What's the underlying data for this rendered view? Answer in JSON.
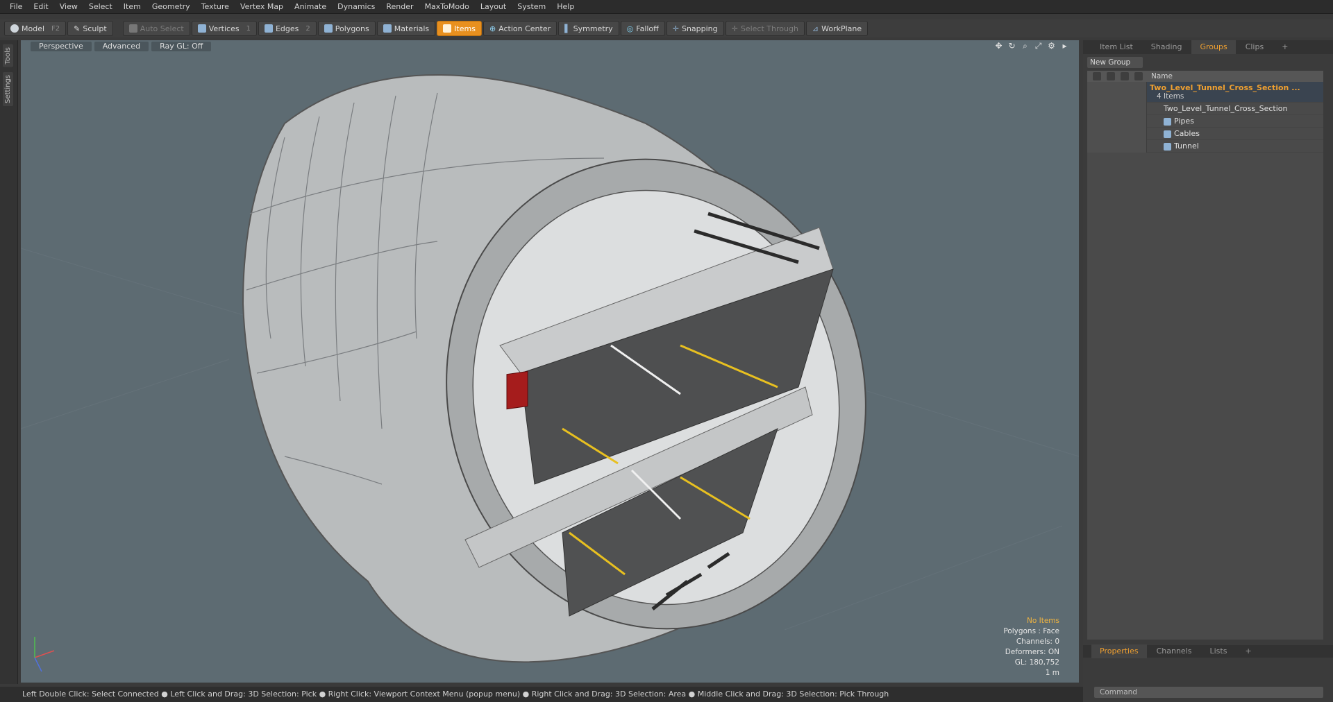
{
  "menu": [
    "File",
    "Edit",
    "View",
    "Select",
    "Item",
    "Geometry",
    "Texture",
    "Vertex Map",
    "Animate",
    "Dynamics",
    "Render",
    "MaxToModo",
    "Layout",
    "System",
    "Help"
  ],
  "toolbar": {
    "model": "Model",
    "model_key": "F2",
    "sculpt": "Sculpt",
    "auto_select": "Auto Select",
    "vertices": "Vertices",
    "vertices_key": "1",
    "edges": "Edges",
    "edges_key": "2",
    "polygons": "Polygons",
    "materials": "Materials",
    "items": "Items",
    "action_center": "Action Center",
    "symmetry": "Symmetry",
    "falloff": "Falloff",
    "snapping": "Snapping",
    "select_through": "Select Through",
    "workplane": "WorkPlane"
  },
  "left_tabs": [
    "Tools",
    "Settings"
  ],
  "viewport": {
    "perspective": "Perspective",
    "advanced": "Advanced",
    "raygl": "Ray GL: Off",
    "info": {
      "items": "No Items",
      "polygons": "Polygons : Face",
      "channels": "Channels: 0",
      "deformers": "Deformers: ON",
      "gl": "GL: 180,752",
      "scale": "1 m"
    }
  },
  "status": "Left Double Click: Select Connected ● Left Click and Drag: 3D Selection: Pick ● Right Click: Viewport Context Menu (popup menu) ● Right Click and Drag: 3D Selection: Area ● Middle Click and Drag: 3D Selection: Pick Through",
  "right_panel": {
    "tabs": [
      "Item List",
      "Shading",
      "Groups",
      "Clips",
      "+"
    ],
    "new_group": "New Group",
    "name_header": "Name",
    "group_name": "Two_Level_Tunnel_Cross_Section ...",
    "group_count": "4 Items",
    "children": [
      "Two_Level_Tunnel_Cross_Section",
      "Pipes",
      "Cables",
      "Tunnel"
    ],
    "bottom_tabs": [
      "Properties",
      "Channels",
      "Lists",
      "+"
    ],
    "command": "Command"
  }
}
